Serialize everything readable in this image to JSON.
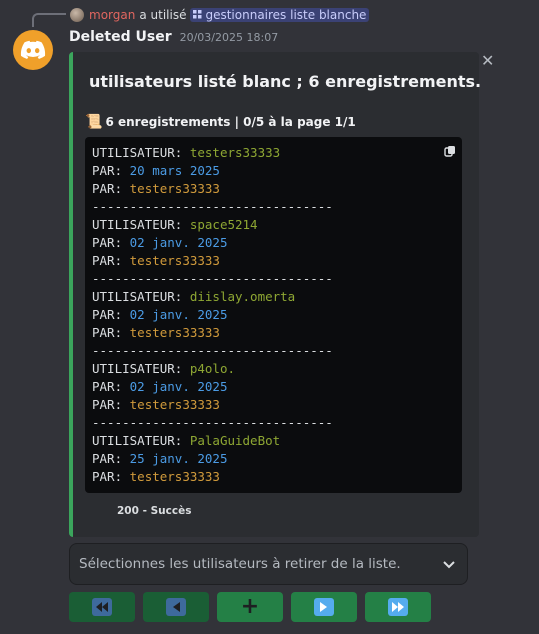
{
  "reply": {
    "username": "morgan",
    "action_text": "a utilisé",
    "command": "gestionnaires liste blanche"
  },
  "message": {
    "author": "Deleted User",
    "timestamp": "20/03/2025 18:07"
  },
  "embed": {
    "accent_color": "#3ba55c",
    "title": "utilisateurs listé blanc ; 6 enregistrements.",
    "description": "6 enregistrements | 0/5 à la page 1/1",
    "description_icon": "scroll-icon",
    "entries": [
      {
        "user_label": "UTILISATEUR: ",
        "user": "testers33333",
        "by_label": "PAR: ",
        "date": "20 mars 2025",
        "by": "testers33333"
      },
      {
        "user_label": "UTILISATEUR: ",
        "user": "space5214",
        "by_label": "PAR: ",
        "date": "02 janv. 2025",
        "by": "testers33333"
      },
      {
        "user_label": "UTILISATEUR: ",
        "user": "diislay.omerta",
        "by_label": "PAR: ",
        "date": "02 janv. 2025",
        "by": "testers33333"
      },
      {
        "user_label": "UTILISATEUR: ",
        "user": "p4olo.",
        "by_label": "PAR: ",
        "date": "02 janv. 2025",
        "by": "testers33333"
      },
      {
        "user_label": "UTILISATEUR: ",
        "user": "PalaGuideBot",
        "by_label": "PAR: ",
        "date": "25 janv. 2025",
        "by": "testers33333"
      }
    ],
    "separator": "--------------------------------",
    "footer": "200 - Succès"
  },
  "select": {
    "placeholder": "Sélectionnes les utilisateurs à retirer de la liste."
  },
  "buttons": [
    {
      "name": "first-page-button",
      "icon": "double-left-icon",
      "enabled": false
    },
    {
      "name": "previous-page-button",
      "icon": "left-icon",
      "enabled": false
    },
    {
      "name": "add-button",
      "icon": "plus-icon",
      "enabled": true
    },
    {
      "name": "next-page-button",
      "icon": "right-icon",
      "enabled": true
    },
    {
      "name": "last-page-button",
      "icon": "double-right-icon",
      "enabled": true
    }
  ]
}
